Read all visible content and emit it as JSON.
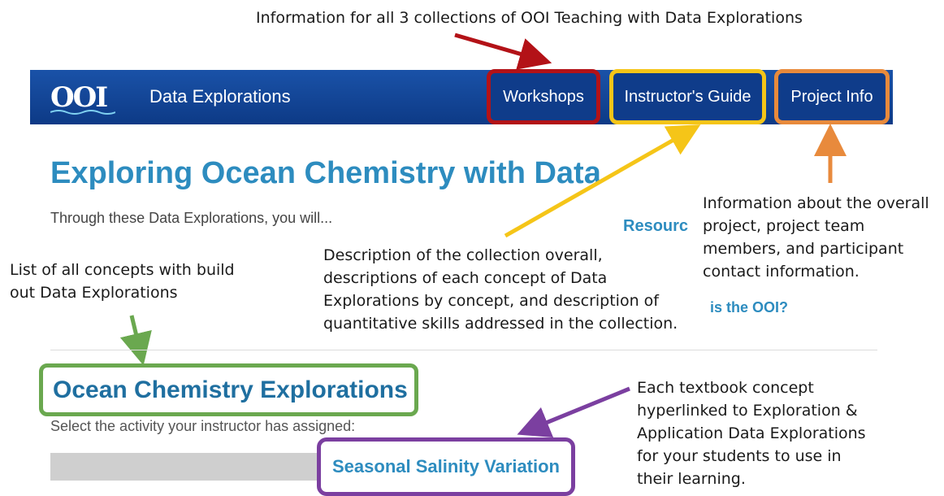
{
  "annotations": {
    "top": "Information for all 3 collections of OOI Teaching with Data Explorations",
    "project_info_lines": [
      "Information about the overall",
      "project, project team",
      "members, and participant",
      "contact information."
    ],
    "instructor_lines": [
      "Description of the collection overall,",
      "descriptions of each concept of Data",
      "Explorations by concept, and description of",
      "quantitative skills addressed in the collection."
    ],
    "concepts_lines": [
      "List of all concepts with build",
      "out Data Explorations"
    ],
    "textbook_lines": [
      "Each textbook concept",
      "hyperlinked to Exploration &",
      "Application Data Explorations",
      "for your students to use in",
      "their learning."
    ]
  },
  "navbar": {
    "logo": "OOI",
    "brand": "Data Explorations",
    "buttons": [
      "Workshops",
      "Instructor's Guide",
      "Project Info"
    ]
  },
  "page": {
    "title": "Exploring Ocean Chemistry with Data",
    "subtitle": "Through these Data Explorations, you will...",
    "resources_partial": "Resourc",
    "ooi_link": "is the OOI?",
    "section_title": "Ocean Chemistry Explorations",
    "select_text": "Select the activity your instructor has assigned:",
    "activity_link": "Seasonal Salinity Variation"
  },
  "colors": {
    "red": "#b31217",
    "yellow": "#f5c518",
    "orange": "#e88a3c",
    "green": "#6aa84f",
    "purple": "#7b3fa0"
  }
}
